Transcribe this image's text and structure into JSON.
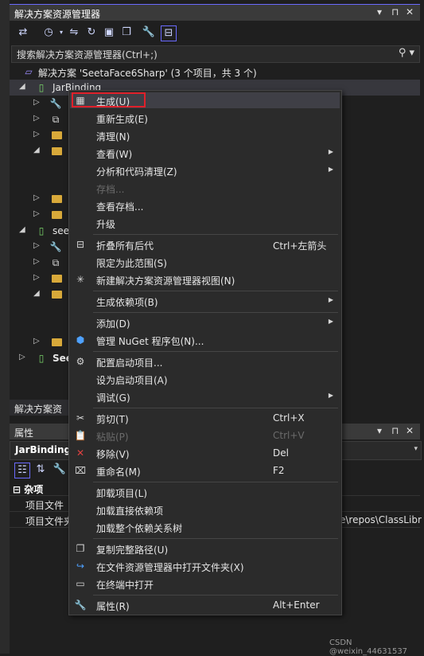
{
  "solution_explorer": {
    "title": "解决方案资源管理器",
    "title_controls": [
      "▾",
      "⊓",
      "✕"
    ],
    "search_placeholder": "搜索解决方案资源管理器(Ctrl+;)",
    "solution_label": "解决方案 'SeetaFace6Sharp' (3 个项目，共 3 个)",
    "tree": [
      {
        "label": "JarBinding",
        "icon": "project-icon",
        "expanded": true
      },
      {
        "label": "",
        "icon": "wrench-icon"
      },
      {
        "label": "",
        "icon": "references-icon"
      },
      {
        "label": "",
        "icon": "folder-icon"
      },
      {
        "label": "",
        "icon": "folder-icon",
        "expanded": true
      },
      {
        "label": "",
        "icon": "file-icon"
      },
      {
        "label": "",
        "icon": "file-icon"
      },
      {
        "label": "",
        "icon": "folder-icon"
      },
      {
        "label": "",
        "icon": "folder-icon"
      },
      {
        "label": "see",
        "icon": "project-icon",
        "expanded": true
      },
      {
        "label": "",
        "icon": "wrench-icon"
      },
      {
        "label": "",
        "icon": "references-icon"
      },
      {
        "label": "",
        "icon": "folder-icon"
      },
      {
        "label": "",
        "icon": "folder-icon",
        "expanded": true
      },
      {
        "label": "",
        "icon": "file-icon"
      },
      {
        "label": "",
        "icon": "file-icon"
      },
      {
        "label": "",
        "icon": "folder-icon"
      },
      {
        "label": "See",
        "icon": "project-icon"
      }
    ],
    "bottom_tab": "解决方案资"
  },
  "properties": {
    "title": "属性",
    "object": "JarBinding",
    "category": "杂项",
    "rows": [
      {
        "key": "项目文件",
        "value": ""
      },
      {
        "key": "项目文件夹",
        "value": "e\\repos\\ClassLibr"
      }
    ]
  },
  "context_menu": {
    "items": [
      {
        "label": "生成(U)",
        "shortcut": "",
        "icon": "build-icon",
        "highlighted": true
      },
      {
        "label": "重新生成(E)",
        "shortcut": "",
        "icon": ""
      },
      {
        "label": "清理(N)",
        "shortcut": "",
        "icon": ""
      },
      {
        "label": "查看(W)",
        "shortcut": "",
        "icon": "",
        "submenu": true
      },
      {
        "label": "分析和代码清理(Z)",
        "shortcut": "",
        "icon": "",
        "submenu": true
      },
      {
        "label": "存档...",
        "shortcut": "",
        "icon": "",
        "disabled": true
      },
      {
        "label": "查看存档...",
        "shortcut": "",
        "icon": ""
      },
      {
        "label": "升级",
        "shortcut": "",
        "icon": ""
      },
      {
        "label": "折叠所有后代",
        "shortcut": "Ctrl+左箭头",
        "icon": "collapse-icon"
      },
      {
        "label": "限定为此范围(S)",
        "shortcut": "",
        "icon": ""
      },
      {
        "label": "新建解决方案资源管理器视图(N)",
        "shortcut": "",
        "icon": "new-view-icon"
      },
      {
        "label": "生成依赖项(B)",
        "shortcut": "",
        "icon": "",
        "submenu": true
      },
      {
        "label": "添加(D)",
        "shortcut": "",
        "icon": "",
        "submenu": true
      },
      {
        "label": "管理 NuGet 程序包(N)...",
        "shortcut": "",
        "icon": "nuget-icon"
      },
      {
        "label": "配置启动项目...",
        "shortcut": "",
        "icon": "gear-icon"
      },
      {
        "label": "设为启动项目(A)",
        "shortcut": "",
        "icon": ""
      },
      {
        "label": "调试(G)",
        "shortcut": "",
        "icon": "",
        "submenu": true
      },
      {
        "label": "剪切(T)",
        "shortcut": "Ctrl+X",
        "icon": "scissors-icon"
      },
      {
        "label": "粘贴(P)",
        "shortcut": "Ctrl+V",
        "icon": "paste-icon",
        "disabled": true
      },
      {
        "label": "移除(V)",
        "shortcut": "Del",
        "icon": "remove-icon"
      },
      {
        "label": "重命名(M)",
        "shortcut": "F2",
        "icon": "rename-icon"
      },
      {
        "label": "卸载项目(L)",
        "shortcut": "",
        "icon": ""
      },
      {
        "label": "加载直接依赖项",
        "shortcut": "",
        "icon": ""
      },
      {
        "label": "加载整个依赖关系树",
        "shortcut": "",
        "icon": ""
      },
      {
        "label": "复制完整路径(U)",
        "shortcut": "",
        "icon": "copy-icon"
      },
      {
        "label": "在文件资源管理器中打开文件夹(X)",
        "shortcut": "",
        "icon": "open-folder-icon"
      },
      {
        "label": "在终端中打开",
        "shortcut": "",
        "icon": "terminal-icon"
      },
      {
        "label": "属性(R)",
        "shortcut": "Alt+Enter",
        "icon": "wrench-icon"
      }
    ]
  },
  "watermark": "CSDN @weixin_44631537",
  "colors": {
    "accent": "#6a6aff",
    "highlight_box": "#e0202a",
    "menu_bg": "#2b2b2b",
    "panel_bg": "#1f1f1f"
  }
}
